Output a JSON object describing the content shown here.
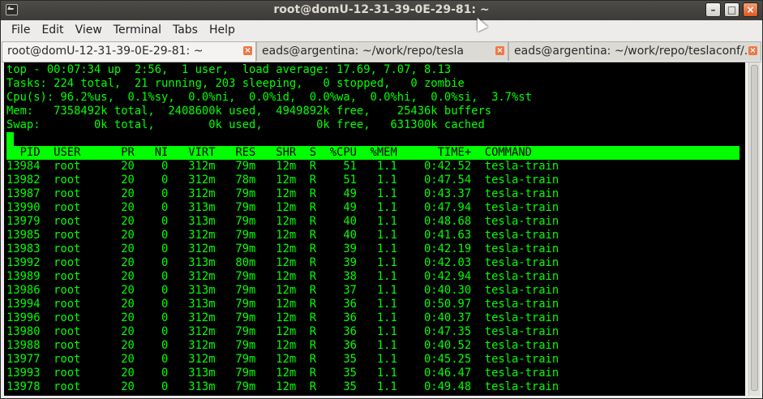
{
  "window": {
    "title": "root@domU-12-31-39-0E-29-81: ~",
    "buttons": {
      "minimize": "–",
      "maximize": "□",
      "close": "×"
    }
  },
  "menu": [
    "File",
    "Edit",
    "View",
    "Terminal",
    "Tabs",
    "Help"
  ],
  "tabs": [
    {
      "label": "root@domU-12-31-39-0E-29-81: ~",
      "active": true
    },
    {
      "label": "eads@argentina: ~/work/repo/tesla",
      "active": false
    },
    {
      "label": "eads@argentina: ~/work/repo/teslaconf/...",
      "active": false
    }
  ],
  "terminal": {
    "summary": [
      "top - 00:07:34 up  2:56,  1 user,  load average: 17.69, 7.07, 8.13",
      "Tasks: 224 total,  21 running, 203 sleeping,   0 stopped,   0 zombie",
      "Cpu(s): 96.2%us,  0.1%sy,  0.0%ni,  0.0%id,  0.0%wa,  0.0%hi,  0.0%si,  3.7%st",
      "Mem:   7358492k total,  2408600k used,  4949892k free,    25436k buffers",
      "Swap:        0k total,        0k used,        0k free,   631300k cached"
    ],
    "columns": [
      "PID",
      "USER",
      "PR",
      "NI",
      "VIRT",
      "RES",
      "SHR",
      "S",
      "%CPU",
      "%MEM",
      "TIME+",
      "COMMAND"
    ],
    "processes": [
      [
        "13984",
        "root",
        "20",
        "0",
        "312m",
        "79m",
        "12m",
        "R",
        "51",
        "1.1",
        "0:42.52",
        "tesla-train"
      ],
      [
        "13982",
        "root",
        "20",
        "0",
        "312m",
        "78m",
        "12m",
        "R",
        "51",
        "1.1",
        "0:47.54",
        "tesla-train"
      ],
      [
        "13987",
        "root",
        "20",
        "0",
        "312m",
        "79m",
        "12m",
        "R",
        "49",
        "1.1",
        "0:43.37",
        "tesla-train"
      ],
      [
        "13990",
        "root",
        "20",
        "0",
        "313m",
        "79m",
        "12m",
        "R",
        "49",
        "1.1",
        "0:47.94",
        "tesla-train"
      ],
      [
        "13979",
        "root",
        "20",
        "0",
        "313m",
        "79m",
        "12m",
        "R",
        "40",
        "1.1",
        "0:48.68",
        "tesla-train"
      ],
      [
        "13985",
        "root",
        "20",
        "0",
        "312m",
        "79m",
        "12m",
        "R",
        "40",
        "1.1",
        "0:41.63",
        "tesla-train"
      ],
      [
        "13983",
        "root",
        "20",
        "0",
        "312m",
        "79m",
        "12m",
        "R",
        "39",
        "1.1",
        "0:42.19",
        "tesla-train"
      ],
      [
        "13992",
        "root",
        "20",
        "0",
        "313m",
        "80m",
        "12m",
        "R",
        "39",
        "1.1",
        "0:42.03",
        "tesla-train"
      ],
      [
        "13989",
        "root",
        "20",
        "0",
        "312m",
        "79m",
        "12m",
        "R",
        "38",
        "1.1",
        "0:42.94",
        "tesla-train"
      ],
      [
        "13986",
        "root",
        "20",
        "0",
        "313m",
        "79m",
        "12m",
        "R",
        "37",
        "1.1",
        "0:40.30",
        "tesla-train"
      ],
      [
        "13994",
        "root",
        "20",
        "0",
        "313m",
        "79m",
        "12m",
        "R",
        "36",
        "1.1",
        "0:50.97",
        "tesla-train"
      ],
      [
        "13996",
        "root",
        "20",
        "0",
        "312m",
        "79m",
        "12m",
        "R",
        "36",
        "1.1",
        "0:40.37",
        "tesla-train"
      ],
      [
        "13980",
        "root",
        "20",
        "0",
        "312m",
        "79m",
        "12m",
        "R",
        "36",
        "1.1",
        "0:47.35",
        "tesla-train"
      ],
      [
        "13988",
        "root",
        "20",
        "0",
        "312m",
        "79m",
        "12m",
        "R",
        "36",
        "1.1",
        "0:40.52",
        "tesla-train"
      ],
      [
        "13977",
        "root",
        "20",
        "0",
        "312m",
        "79m",
        "12m",
        "R",
        "35",
        "1.1",
        "0:45.25",
        "tesla-train"
      ],
      [
        "13993",
        "root",
        "20",
        "0",
        "313m",
        "79m",
        "12m",
        "R",
        "35",
        "1.1",
        "0:46.47",
        "tesla-train"
      ],
      [
        "13978",
        "root",
        "20",
        "0",
        "313m",
        "79m",
        "12m",
        "R",
        "35",
        "1.1",
        "0:49.48",
        "tesla-train"
      ]
    ]
  },
  "colors": {
    "terminal_fg": "#00ff00",
    "terminal_bg": "#000000",
    "titlebar": "#3c3b37",
    "close_accent": "#f07746"
  }
}
